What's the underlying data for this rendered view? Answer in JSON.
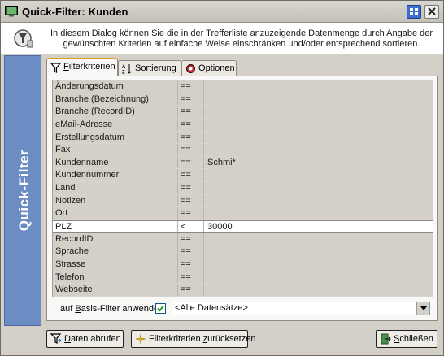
{
  "window": {
    "title": "Quick-Filter: Kunden"
  },
  "header": {
    "text": "In diesem Dialog können Sie die in der Trefferliste anzuzeigende Datenmenge durch Angabe der gewünschten Kriterien auf einfache Weise einschränken und/oder entsprechend sortieren."
  },
  "sidebar": {
    "label": "Quick-Filter"
  },
  "tabs": [
    {
      "pre": "",
      "u": "F",
      "post": "ilterkriterien",
      "icon": "funnel-icon",
      "active": true
    },
    {
      "pre": "",
      "u": "S",
      "post": "ortierung",
      "icon": "sort-az-icon",
      "active": false
    },
    {
      "pre": "",
      "u": "O",
      "post": "ptionen",
      "icon": "options-icon",
      "active": false
    }
  ],
  "filter_rows": [
    {
      "field": "Änderungsdatum",
      "op": "==",
      "value": ""
    },
    {
      "field": "Branche (Bezeichnung)",
      "op": "==",
      "value": ""
    },
    {
      "field": "Branche (RecordID)",
      "op": "==",
      "value": ""
    },
    {
      "field": "eMail-Adresse",
      "op": "==",
      "value": ""
    },
    {
      "field": "Erstellungsdatum",
      "op": "==",
      "value": ""
    },
    {
      "field": "Fax",
      "op": "==",
      "value": ""
    },
    {
      "field": "Kundenname",
      "op": "==",
      "value": "Schmi*"
    },
    {
      "field": "Kundennummer",
      "op": "==",
      "value": ""
    },
    {
      "field": "Land",
      "op": "==",
      "value": ""
    },
    {
      "field": "Notizen",
      "op": "==",
      "value": ""
    },
    {
      "field": "Ort",
      "op": "==",
      "value": ""
    },
    {
      "field": "PLZ",
      "op": "<",
      "value": "30000",
      "selected": true
    },
    {
      "field": "RecordID",
      "op": "==",
      "value": ""
    },
    {
      "field": "Sprache",
      "op": "==",
      "value": ""
    },
    {
      "field": "Strasse",
      "op": "==",
      "value": ""
    },
    {
      "field": "Telefon",
      "op": "==",
      "value": ""
    },
    {
      "field": "Webseite",
      "op": "==",
      "value": ""
    }
  ],
  "basis": {
    "pre": "auf ",
    "u": "B",
    "post": "asis-Filter anwenden",
    "checked": true,
    "select_value": "<Alle Datensätze>"
  },
  "buttons": {
    "abrufen": {
      "pre": "",
      "u": "D",
      "post": "aten abrufen"
    },
    "reset": {
      "pre": "Filterkriterien ",
      "u": "z",
      "post": "urücksetzen"
    },
    "close": {
      "pre": "",
      "u": "S",
      "post": "chließen"
    }
  },
  "colors": {
    "sidebar": "#6c8dc4",
    "accent_tab": "#e2a029",
    "selected_row": "#ffffff"
  }
}
